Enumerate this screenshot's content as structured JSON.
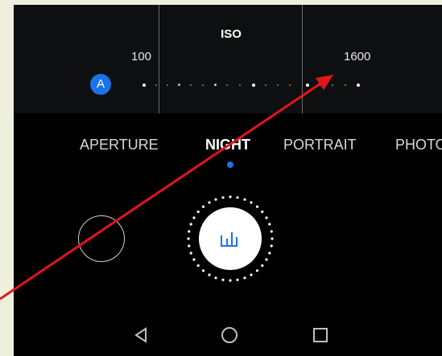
{
  "iso": {
    "title": "ISO",
    "tick_labels": [
      "100",
      "1600"
    ],
    "auto_badge": "A"
  },
  "modes": {
    "items": [
      "APERTURE",
      "NIGHT",
      "PORTRAIT",
      "PHOTO"
    ],
    "active": "NIGHT"
  },
  "colors": {
    "accent": "#1a73e8",
    "annotation_arrow": "#e3151b",
    "frame_background": "#eef0dd"
  },
  "icons": {
    "shutter": "night-bars-icon",
    "nav_back": "back-triangle-icon",
    "nav_home": "home-circle-icon",
    "nav_recents": "recents-square-icon"
  }
}
